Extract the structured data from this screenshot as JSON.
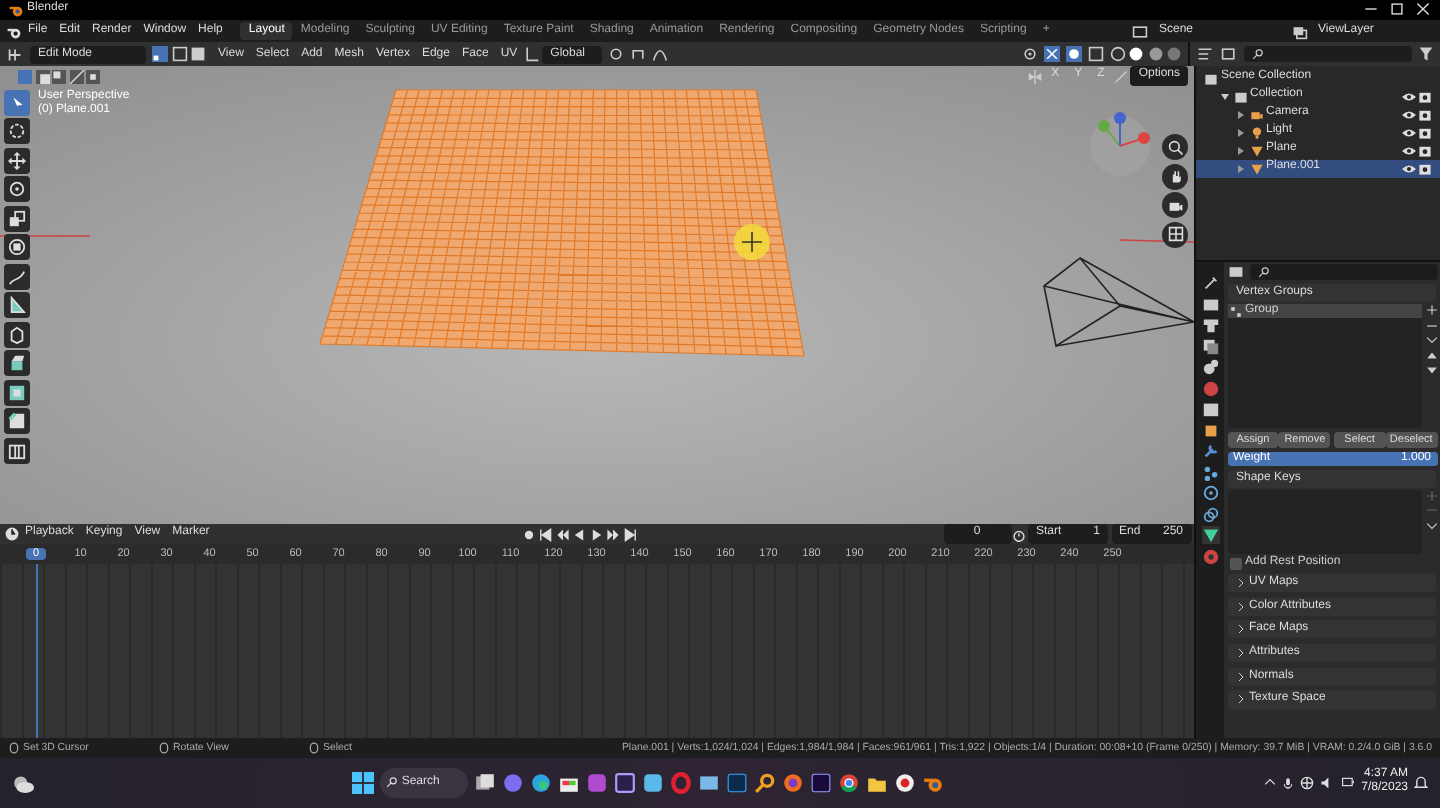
{
  "title_bar": {
    "title": "Blender"
  },
  "menu": [
    "File",
    "Edit",
    "Render",
    "Window",
    "Help"
  ],
  "workspaces": [
    {
      "label": "Layout",
      "selected": true
    },
    {
      "label": "Modeling",
      "selected": false
    },
    {
      "label": "Sculpting",
      "selected": false
    },
    {
      "label": "UV Editing",
      "selected": false
    },
    {
      "label": "Texture Paint",
      "selected": false
    },
    {
      "label": "Shading",
      "selected": false
    },
    {
      "label": "Animation",
      "selected": false
    },
    {
      "label": "Rendering",
      "selected": false
    },
    {
      "label": "Compositing",
      "selected": false
    },
    {
      "label": "Geometry Nodes",
      "selected": false
    },
    {
      "label": "Scripting",
      "selected": false
    }
  ],
  "add_workspace": "+",
  "scene": "Scene",
  "view_layer": "ViewLayer",
  "viewport_header": {
    "mode": "Edit Mode",
    "menus": [
      "View",
      "Select",
      "Add",
      "Mesh",
      "Vertex",
      "Edge",
      "Face",
      "UV"
    ],
    "orientation": "Global",
    "axes": [
      "X",
      "Y",
      "Z"
    ],
    "options": "Options"
  },
  "viewport": {
    "overlay": [
      "User Perspective",
      "(0) Plane.001"
    ]
  },
  "outliner": {
    "root": "Scene Collection",
    "items": [
      {
        "label": "Collection",
        "kind": "collection",
        "selected": false,
        "expanded": true,
        "children": [
          {
            "label": "Camera",
            "kind": "camera",
            "selected": false
          },
          {
            "label": "Light",
            "kind": "light",
            "selected": false
          },
          {
            "label": "Plane",
            "kind": "mesh",
            "selected": false
          },
          {
            "label": "Plane.001",
            "kind": "mesh",
            "selected": true
          }
        ]
      }
    ]
  },
  "properties": {
    "vertex_groups": {
      "title": "Vertex Groups",
      "groups": [
        {
          "label": "Group",
          "selected": true
        }
      ],
      "buttons": [
        "Assign",
        "Remove",
        "Select",
        "Deselect"
      ],
      "weight": {
        "label": "Weight",
        "value": "1.000",
        "level": 1
      }
    },
    "shape_keys": {
      "title": "Shape Keys",
      "add_rest_label": "Add Rest Position",
      "add_rest_checked": false
    },
    "sections": [
      "UV Maps",
      "Color Attributes",
      "Face Maps",
      "Attributes",
      "Normals",
      "Texture Space"
    ]
  },
  "timeline": {
    "menus": [
      "Playback",
      "Keying",
      "View",
      "Marker"
    ],
    "current_frame": "0",
    "start_label": "Start",
    "start": "1",
    "end_label": "End",
    "end": "250",
    "ticks": [
      "0",
      "10",
      "20",
      "30",
      "40",
      "50",
      "60",
      "70",
      "80",
      "90",
      "100",
      "110",
      "120",
      "130",
      "140",
      "150",
      "160",
      "170",
      "180",
      "190",
      "200",
      "210",
      "220",
      "230",
      "240",
      "250"
    ]
  },
  "status_bar": {
    "hints": [
      "Set 3D Cursor",
      "Rotate View",
      "Select"
    ],
    "stats": "Plane.001 | Verts:1,024/1,024 | Edges:1,984/1,984 | Faces:961/961 | Tris:1,922 | Objects:1/4 | Duration: 00:08+10 (Frame 0/250) | Memory: 39.7 MiB | VRAM: 0.2/4.0 GiB | 3.6.0"
  },
  "taskbar": {
    "search": "Search",
    "time": "4:37 AM",
    "date": "7/8/2023"
  }
}
